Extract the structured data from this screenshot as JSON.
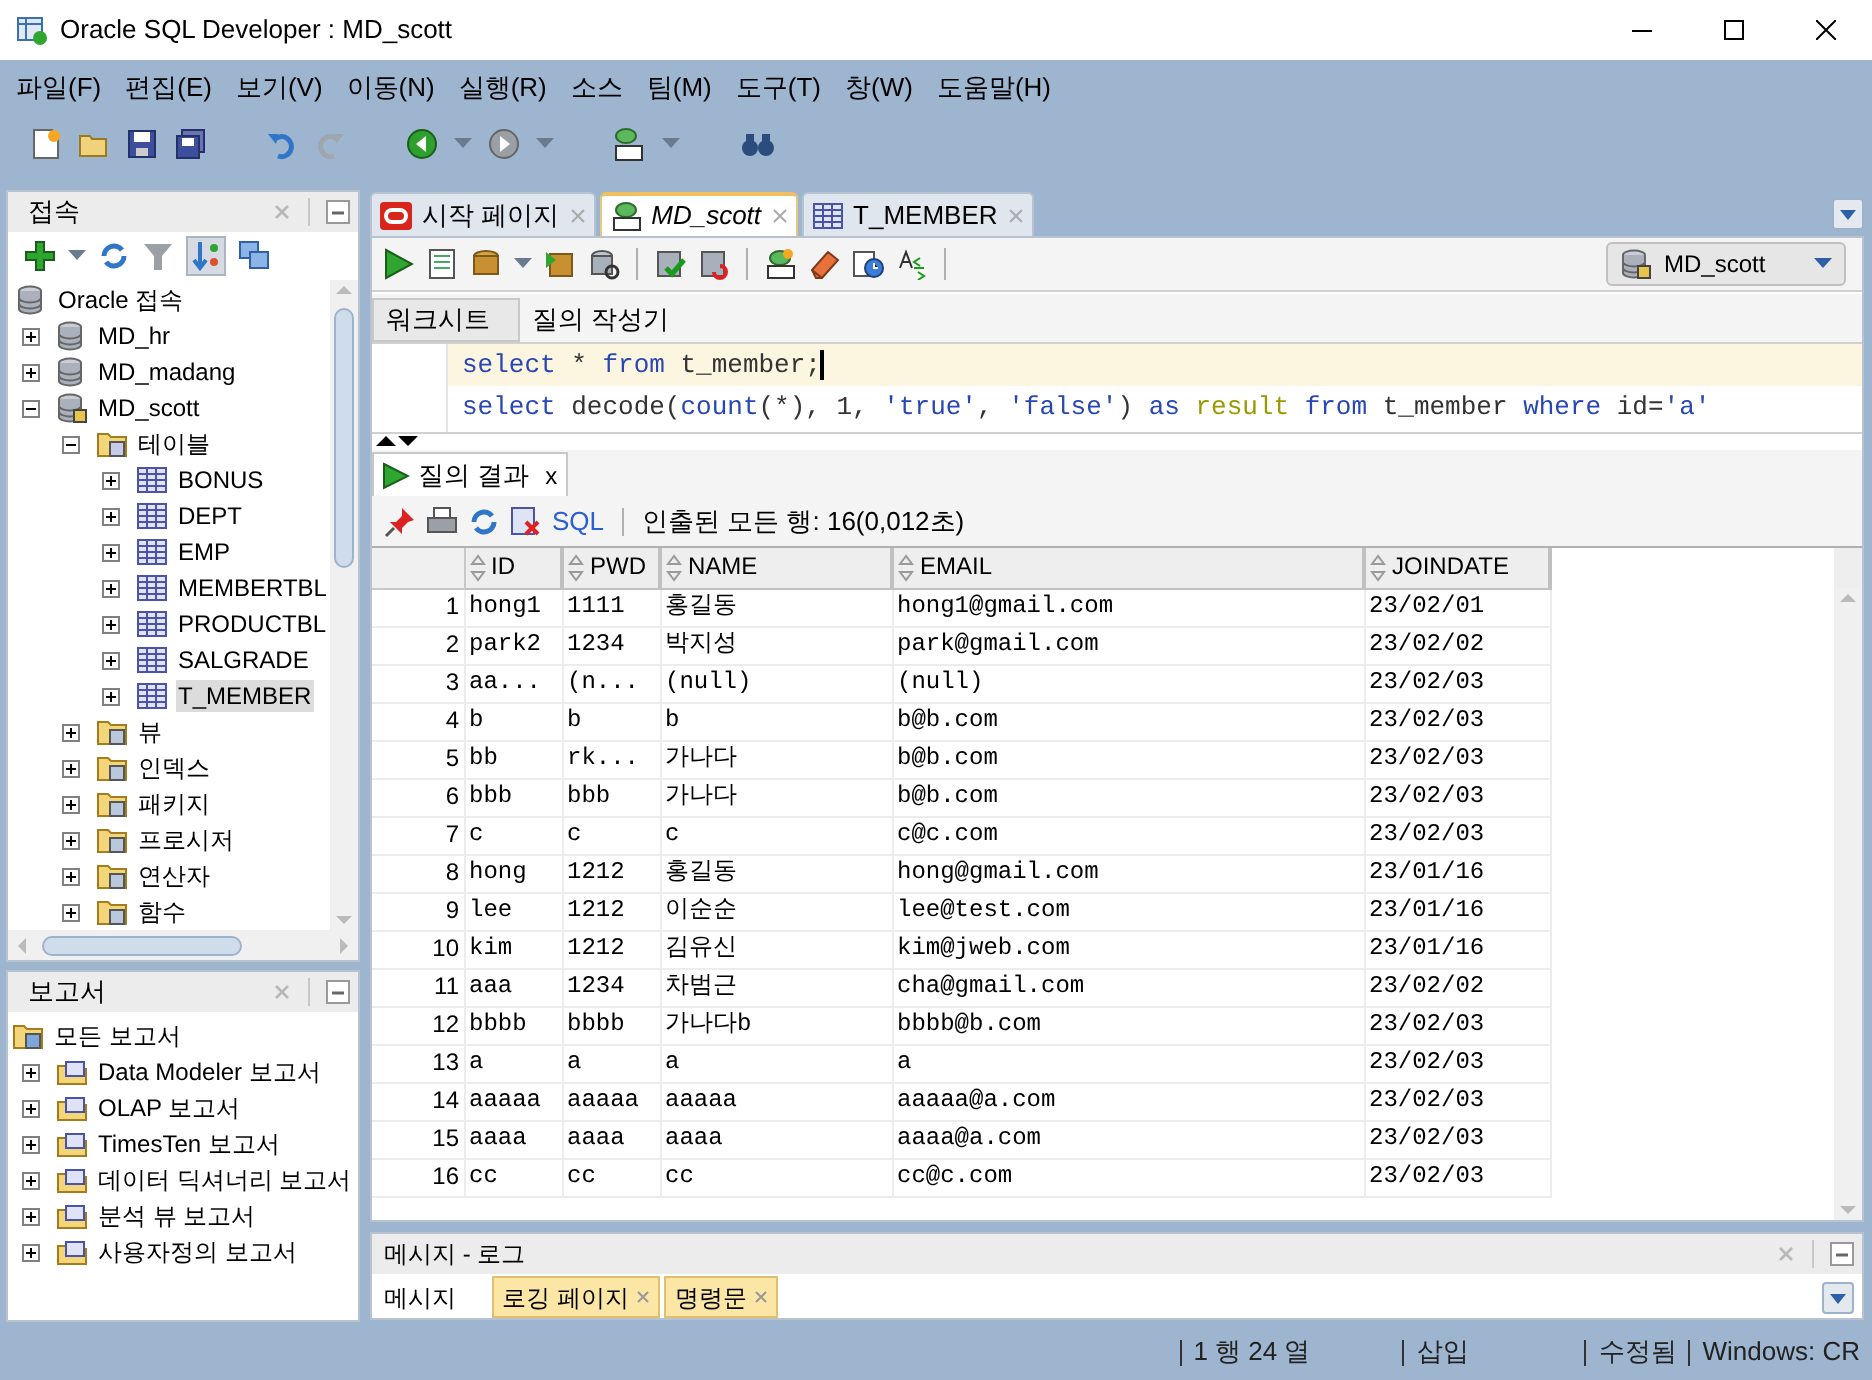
{
  "window": {
    "title": "Oracle SQL Developer : MD_scott"
  },
  "menu": [
    "파일(F)",
    "편집(E)",
    "보기(V)",
    "이동(N)",
    "실행(R)",
    "소스",
    "팀(M)",
    "도구(T)",
    "창(W)",
    "도움말(H)"
  ],
  "connections_panel": {
    "title": "접속",
    "root": {
      "label": "Oracle 접속",
      "kind": "db"
    },
    "items": [
      {
        "label": "MD_hr",
        "kind": "db",
        "expanded": false,
        "selected": false
      },
      {
        "label": "MD_madang",
        "kind": "db",
        "expanded": false,
        "selected": false
      },
      {
        "label": "MD_scott",
        "kind": "connection",
        "expanded": true,
        "selected": false,
        "children": [
          {
            "label": "테이블",
            "kind": "table-folder",
            "expanded": true,
            "selected": false,
            "children": [
              {
                "label": "BONUS",
                "kind": "table",
                "expanded": false,
                "selected": false
              },
              {
                "label": "DEPT",
                "kind": "table",
                "expanded": false,
                "selected": false
              },
              {
                "label": "EMP",
                "kind": "table",
                "expanded": false,
                "selected": false
              },
              {
                "label": "MEMBERTBL",
                "kind": "table",
                "expanded": false,
                "selected": false
              },
              {
                "label": "PRODUCTBL",
                "kind": "table",
                "expanded": false,
                "selected": false
              },
              {
                "label": "SALGRADE",
                "kind": "table",
                "expanded": false,
                "selected": false
              },
              {
                "label": "T_MEMBER",
                "kind": "table",
                "expanded": false,
                "selected": true
              }
            ]
          },
          {
            "label": "뷰",
            "kind": "folder",
            "expanded": false,
            "selected": false
          },
          {
            "label": "인덱스",
            "kind": "folder",
            "expanded": false,
            "selected": false
          },
          {
            "label": "패키지",
            "kind": "folder",
            "expanded": false,
            "selected": false
          },
          {
            "label": "프로시저",
            "kind": "folder",
            "expanded": false,
            "selected": false
          },
          {
            "label": "연산자",
            "kind": "folder",
            "expanded": false,
            "selected": false
          },
          {
            "label": "함수",
            "kind": "folder",
            "expanded": false,
            "selected": false
          }
        ]
      }
    ]
  },
  "reports_panel": {
    "title": "보고서",
    "root": {
      "label": "모든 보고서",
      "kind": "reports"
    },
    "items": [
      {
        "label": "Data Modeler 보고서",
        "kind": "report-folder",
        "expanded": false,
        "selected": false
      },
      {
        "label": "OLAP 보고서",
        "kind": "report-folder",
        "expanded": false,
        "selected": false
      },
      {
        "label": "TimesTen 보고서",
        "kind": "report-folder",
        "expanded": false,
        "selected": false
      },
      {
        "label": "데이터 딕셔너리 보고서",
        "kind": "report-folder",
        "expanded": false,
        "selected": false
      },
      {
        "label": "분석 뷰 보고서",
        "kind": "report-folder",
        "expanded": false,
        "selected": false
      },
      {
        "label": "사용자정의 보고서",
        "kind": "report-folder",
        "expanded": false,
        "selected": false
      }
    ]
  },
  "editor_tabs": [
    {
      "label": "시작 페이지",
      "kind": "start",
      "selected": false
    },
    {
      "label": "MD_scott",
      "kind": "worksheet",
      "selected": true
    },
    {
      "label": "T_MEMBER",
      "kind": "table",
      "selected": false
    }
  ],
  "connection_select": {
    "value": "MD_scott"
  },
  "worksheet_tabs": [
    {
      "label": "워크시트",
      "selected": true
    },
    {
      "label": "질의 작성기",
      "selected": false
    }
  ],
  "sql_lines": [
    {
      "current": true,
      "tokens": [
        {
          "text": "select",
          "kind": "keyword"
        },
        {
          "text": " * ",
          "kind": "plain"
        },
        {
          "text": "from",
          "kind": "keyword"
        },
        {
          "text": " t_member;",
          "kind": "plain"
        }
      ]
    },
    {
      "current": false,
      "tokens": [
        {
          "text": "select",
          "kind": "keyword"
        },
        {
          "text": " decode(",
          "kind": "plain"
        },
        {
          "text": "count",
          "kind": "keyword"
        },
        {
          "text": "(*), 1, ",
          "kind": "plain"
        },
        {
          "text": "'true'",
          "kind": "string"
        },
        {
          "text": ", ",
          "kind": "plain"
        },
        {
          "text": "'false'",
          "kind": "string"
        },
        {
          "text": ") ",
          "kind": "plain"
        },
        {
          "text": "as ",
          "kind": "keyword"
        },
        {
          "text": "result ",
          "kind": "alias"
        },
        {
          "text": "from",
          "kind": "keyword"
        },
        {
          "text": " t_member ",
          "kind": "plain"
        },
        {
          "text": "where",
          "kind": "keyword"
        },
        {
          "text": " id=",
          "kind": "plain"
        },
        {
          "text": "'a'",
          "kind": "string"
        }
      ]
    }
  ],
  "results": {
    "tab": "질의 결과",
    "tab_close": "x",
    "sql_link": "SQL",
    "status": "인출된 모든 행: 16(0,012초)",
    "columns": [
      "ID",
      "PWD",
      "NAME",
      "EMAIL",
      "JOINDATE"
    ],
    "rows": [
      {
        "n": "1",
        "cells": [
          "hong1",
          "1111",
          "홍길동",
          "hong1@gmail.com",
          "23/02/01"
        ]
      },
      {
        "n": "2",
        "cells": [
          "park2",
          "1234",
          "박지성",
          "park@gmail.com",
          "23/02/02"
        ]
      },
      {
        "n": "3",
        "cells": [
          "aa...",
          "(n...",
          "(null)",
          "(null)",
          "23/02/03"
        ]
      },
      {
        "n": "4",
        "cells": [
          "b",
          "b",
          "b",
          "b@b.com",
          "23/02/03"
        ]
      },
      {
        "n": "5",
        "cells": [
          "bb",
          "rk...",
          "가나다",
          "b@b.com",
          "23/02/03"
        ]
      },
      {
        "n": "6",
        "cells": [
          "bbb",
          "bbb",
          "가나다",
          "b@b.com",
          "23/02/03"
        ]
      },
      {
        "n": "7",
        "cells": [
          "c",
          "c",
          "c",
          "c@c.com",
          "23/02/03"
        ]
      },
      {
        "n": "8",
        "cells": [
          "hong",
          "1212",
          "홍길동",
          "hong@gmail.com",
          "23/01/16"
        ]
      },
      {
        "n": "9",
        "cells": [
          "lee",
          "1212",
          "이순순",
          "lee@test.com",
          "23/01/16"
        ]
      },
      {
        "n": "10",
        "cells": [
          "kim",
          "1212",
          "김유신",
          "kim@jweb.com",
          "23/01/16"
        ]
      },
      {
        "n": "11",
        "cells": [
          "aaa",
          "1234",
          "차범근",
          "cha@gmail.com",
          "23/02/02"
        ]
      },
      {
        "n": "12",
        "cells": [
          "bbbb",
          "bbbb",
          "가나다b",
          "bbbb@b.com",
          "23/02/03"
        ]
      },
      {
        "n": "13",
        "cells": [
          "a",
          "a",
          "a",
          "a",
          "23/02/03"
        ]
      },
      {
        "n": "14",
        "cells": [
          "aaaaa",
          "aaaaa",
          "aaaaa",
          "aaaaa@a.com",
          "23/02/03"
        ]
      },
      {
        "n": "15",
        "cells": [
          "aaaa",
          "aaaa",
          "aaaa",
          "aaaa@a.com",
          "23/02/03"
        ]
      },
      {
        "n": "16",
        "cells": [
          "cc",
          "cc",
          "cc",
          "cc@c.com",
          "23/02/03"
        ]
      }
    ]
  },
  "messages_panel": {
    "title": "메시지 - 로그",
    "tabs": [
      {
        "label": "메시지",
        "selected": true,
        "closable": false
      },
      {
        "label": "로깅 페이지",
        "selected": false,
        "closable": true
      },
      {
        "label": "명령문",
        "selected": false,
        "closable": true
      }
    ]
  },
  "status_bar": [
    "1 행 24 열",
    "삽입",
    "수정됨",
    "Windows: CR"
  ]
}
